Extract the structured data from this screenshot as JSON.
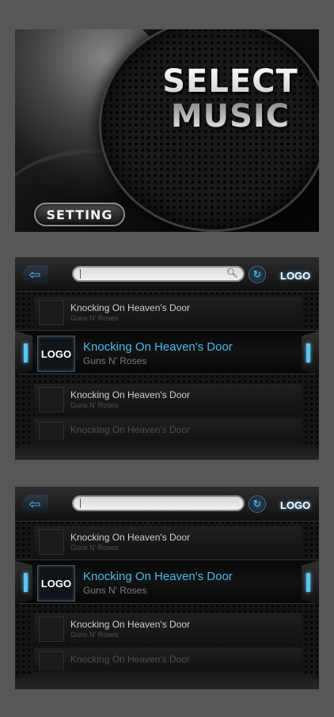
{
  "splash": {
    "title_line1": "SELECT",
    "title_line2": "MUSIC",
    "setting_label": "SETTING"
  },
  "list_panels": [
    {
      "logo": "LOGO",
      "search_value": "",
      "prev_item": {
        "title": "Knocking On Heaven's Door",
        "artist": "Guns N' Roses"
      },
      "selected": {
        "logo": "LOGO",
        "title": "Knocking On Heaven's Door",
        "artist": "Guns N' Roses"
      },
      "next_item": {
        "title": "Knocking On Heaven's Door",
        "artist": "Guns N' Roses"
      },
      "faded_item": {
        "title": "Knocking On Heaven's Door"
      }
    },
    {
      "logo": "LOGO",
      "search_value": "",
      "prev_item": {
        "title": "Knocking On Heaven's Door",
        "artist": "Guns N' Roses"
      },
      "selected": {
        "logo": "LOGO",
        "title": "Knocking On Heaven's Door",
        "artist": "Guns N' Roses"
      },
      "next_item": {
        "title": "Knocking On Heaven's Door",
        "artist": "Guns N' Roses"
      },
      "faded_item": {
        "title": "Knocking On Heaven's Door"
      }
    }
  ],
  "icons": {
    "back": "back-arrow-icon",
    "search": "search-icon",
    "refresh": "refresh-icon"
  },
  "colors": {
    "accent": "#4ab9ea",
    "background": "#575757"
  }
}
